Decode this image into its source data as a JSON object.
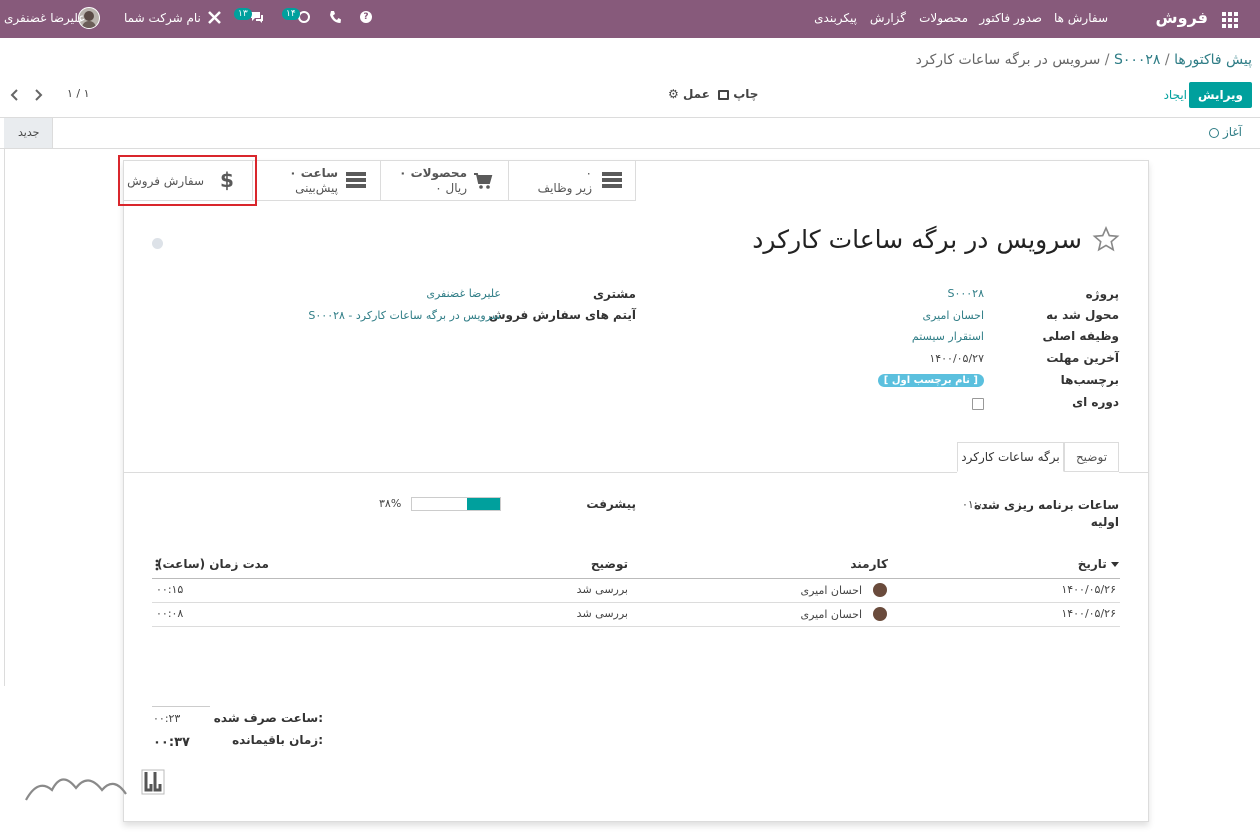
{
  "topbar": {
    "app_name": "فروش",
    "menu": [
      "سفارش ها",
      "صدور فاکتور",
      "محصولات",
      "گزارش",
      "پیکربندی"
    ],
    "user_name": "علیرضا غضنفری",
    "company_name": "نام شرکت شما",
    "messages_count": "۱۳",
    "activities_count": "۱۴"
  },
  "breadcrumb": {
    "root": "پیش فاکتورها",
    "order": "S۰۰۰۲۸",
    "current": "سرویس در برگه ساعات کارکرد",
    "separator": "/"
  },
  "controls": {
    "edit": "ویرایش",
    "create": "ایجاد",
    "print": "چاپ",
    "action": "عمل",
    "pager": "۱ / ۱"
  },
  "statusbar": {
    "start": "آغاز",
    "new": "جدید"
  },
  "smart_buttons": {
    "sales_order": "سفارش فروش",
    "planned_hours_value": "۰ ساعت",
    "planned_hours_label": "پیش‌بینی",
    "products_value": "۰ محصولات",
    "products_sub": "۰ ریال",
    "subtasks_value": "۰",
    "subtasks_label": "زیر وظایف"
  },
  "task": {
    "title": "سرویس در برگه ساعات کارکرد",
    "fields": {
      "project_label": "پروژه",
      "project_value": "S۰۰۰۲۸",
      "assigned_label": "محول شد به",
      "assigned_value": "احسان امیری",
      "parent_label": "وظیفه اصلی",
      "parent_value": "استقرار سیستم",
      "deadline_label": "آخرین مهلت",
      "deadline_value": "۱۴۰۰/۰۵/۲۷",
      "tags_label": "برچسب‌ها",
      "tags_value": "[ نام برچسب اول ]",
      "recurring_label": "دوره ای",
      "customer_label": "مشتری",
      "customer_value": "علیرضا غضنفری",
      "so_item_label": "آیتم های سفارش فروش",
      "so_item_value": "S۰۰۰۲۸ - سرویس در برگه ساعات کارکرد"
    }
  },
  "tabs": {
    "timesheets": "برگه ساعات کارکرد",
    "description": "توضیح"
  },
  "timesheet": {
    "planned_label": "ساعات برنامه ریزی شده اولیه",
    "planned_value": "۰۱:۰۰",
    "progress_label": "پیشرفت",
    "progress_text": "۳۸%",
    "progress_fraction": 0.38,
    "headers": {
      "date": "تاریخ",
      "employee": "کارمند",
      "description": "توضیح",
      "duration": "مدت زمان (ساعت)"
    },
    "rows": [
      {
        "date": "۱۴۰۰/۰۵/۲۶",
        "employee": "احسان امیری",
        "description": "بررسی شد",
        "duration": "۰۰:۱۵"
      },
      {
        "date": "۱۴۰۰/۰۵/۲۶",
        "employee": "احسان امیری",
        "description": "بررسی شد",
        "duration": "۰۰:۰۸"
      }
    ],
    "spent_label": "ساعت صرف شده:",
    "spent_value": "۰۰:۲۳",
    "remaining_label": "زمان باقیمانده:",
    "remaining_value": "۰۰:۳۷"
  },
  "colors": {
    "topbar": "#875a7b",
    "primary": "#00a09d",
    "link": "#2f7d86",
    "highlight_border": "#d9262c",
    "tag": "#5bc0de"
  }
}
